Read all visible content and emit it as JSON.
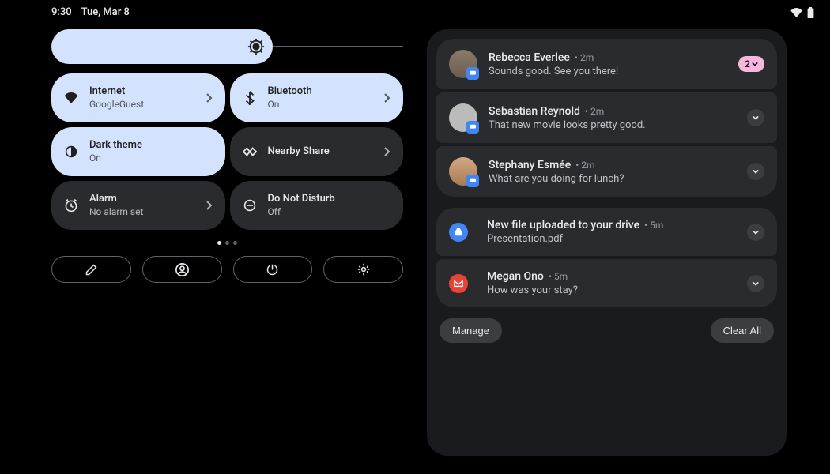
{
  "status": {
    "time": "9:30",
    "date": "Tue, Mar 8"
  },
  "tiles": {
    "internet": {
      "title": "Internet",
      "sub": "GoogleGuest"
    },
    "bluetooth": {
      "title": "Bluetooth",
      "sub": "On"
    },
    "darktheme": {
      "title": "Dark theme",
      "sub": "On"
    },
    "nearby": {
      "title": "Nearby Share"
    },
    "alarm": {
      "title": "Alarm",
      "sub": "No alarm set"
    },
    "dnd": {
      "title": "Do Not Disturb",
      "sub": "Off"
    }
  },
  "notifications": {
    "group1": [
      {
        "title": "Rebecca Everlee",
        "time": "2m",
        "msg": "Sounds good. See you there!",
        "count": "2"
      },
      {
        "title": "Sebastian Reynold",
        "time": "2m",
        "msg": "That new movie looks pretty good."
      },
      {
        "title": "Stephany Esmée",
        "time": "2m",
        "msg": "What are you doing for lunch?"
      }
    ],
    "group2": [
      {
        "title": "New file uploaded to your drive",
        "time": "5m",
        "msg": "Presentation.pdf"
      },
      {
        "title": "Megan Ono",
        "time": "5m",
        "msg": "How was your stay?"
      }
    ]
  },
  "actions": {
    "manage": "Manage",
    "clearAll": "Clear All"
  }
}
